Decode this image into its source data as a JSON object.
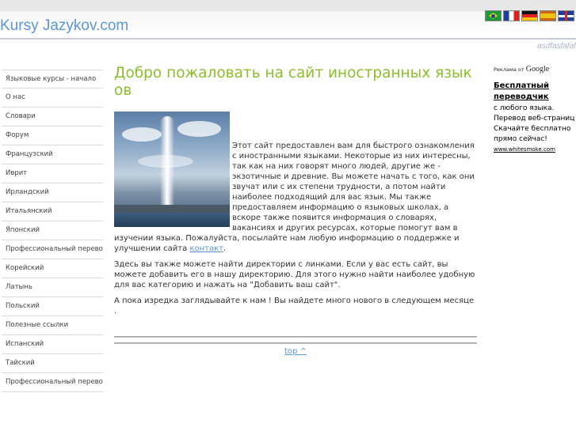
{
  "header": {
    "title": "Kursy Jazykov.com",
    "tagline": "asdfasfafaf",
    "flags": [
      {
        "name": "brazil-flag-icon",
        "lang": "Português"
      },
      {
        "name": "france-flag-icon",
        "lang": "Français"
      },
      {
        "name": "germany-flag-icon",
        "lang": "Deutsch"
      },
      {
        "name": "spain-flag-icon",
        "lang": "Español"
      },
      {
        "name": "uk-flag-icon",
        "lang": "English"
      }
    ]
  },
  "sidebar": {
    "items": [
      {
        "label": "Языковые курсы - начало"
      },
      {
        "label": "О нас"
      },
      {
        "label": "Словари"
      },
      {
        "label": "Форум"
      },
      {
        "label": "Французский"
      },
      {
        "label": "Иврит"
      },
      {
        "label": "Ирландский"
      },
      {
        "label": "Итальянский"
      },
      {
        "label": "Японский"
      },
      {
        "label": "Профессиональный перевод"
      },
      {
        "label": "Корейский"
      },
      {
        "label": "Латынь"
      },
      {
        "label": "Польский"
      },
      {
        "label": "Полезные ссылки"
      },
      {
        "label": "Испанский"
      },
      {
        "label": "Тайский"
      },
      {
        "label": "Профессиональный перевод"
      }
    ]
  },
  "main": {
    "title": "Добро пожаловать на сайт иностранных языков",
    "para1": "Этот сайт предоставлен вам для быстрого ознакомления с иностранными языками. Некоторые из них интересны, так как на них говорят много людей, другие же - экзотичные и древние. Вы можете начать с того, как они звучат или с их степени трудности, а потом найти наиболее подходящий для вас язык. Мы также предоставляем информацию о языковых школах, а вскоре также появится информация о словарях, вакансиях и других ресурсах, которые помогут вам в изучении языка.  Пожалуйста, посылайте нам любую информацию о поддержке и улучшении сайта ",
    "contact_link": "контакт",
    "para1_end": ".",
    "para2": "Здесь вы также можете найти директории с линками. Если у вас есть сайт, вы можете добавить его в нашу директорию. Для этого нужно найти наиболее удобную для вас категорию и нажать на \"Добавить ваш сайт\".",
    "para3": "А пока изредка заглядывайте к нам ! Вы найдете много нового в следующем месяце .",
    "top_link": "top ^"
  },
  "ads": {
    "label": "Реклама от ",
    "label_brand": "Google",
    "title": "Бесплатный переводчик",
    "text": "с любого языка. Перевод веб-страниц Скачайте бесплатно прямо сейчас!",
    "url": "www.whitesmoke.com"
  }
}
